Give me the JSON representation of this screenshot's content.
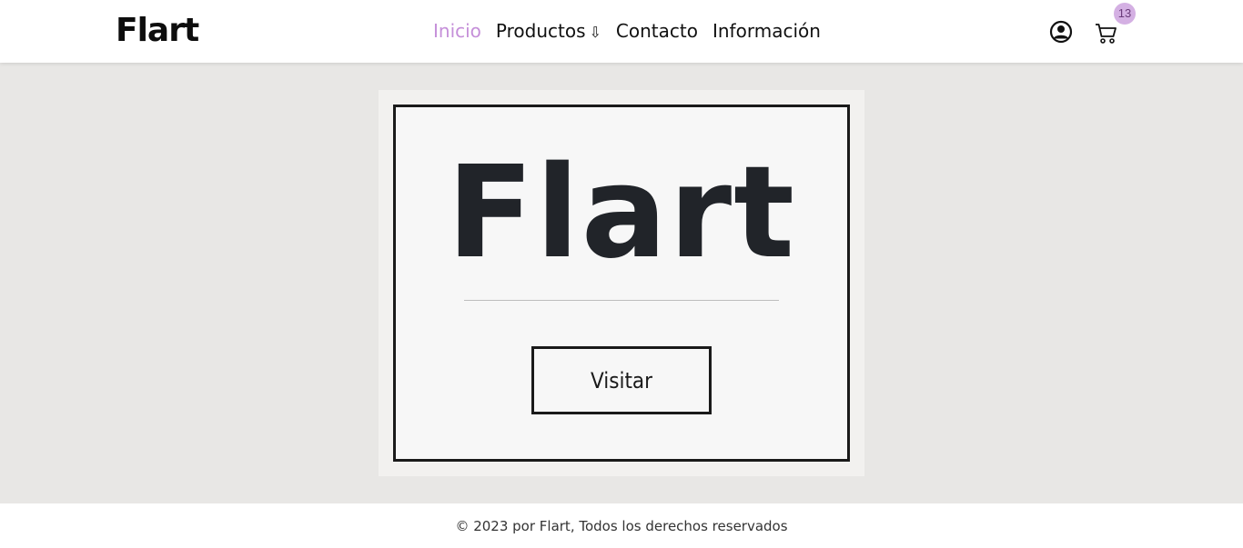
{
  "header": {
    "brand": "Flart",
    "nav": [
      {
        "label": "Inicio",
        "active": true
      },
      {
        "label": "Productos",
        "arrow": "⇩"
      },
      {
        "label": "Contacto"
      },
      {
        "label": "Información"
      }
    ],
    "icons": {
      "user": "user-circle-icon",
      "cart": "cart-icon"
    },
    "cart_count": "13"
  },
  "hero": {
    "title": "Flart",
    "button_label": "Visitar"
  },
  "footer": {
    "text": "© 2023 por Flart, Todos los derechos reservados"
  },
  "colors": {
    "accent": "#c58fd9",
    "badge_bg": "#d4b0e3",
    "page_bg": "#e8e7e5",
    "hero_text": "#212429"
  }
}
